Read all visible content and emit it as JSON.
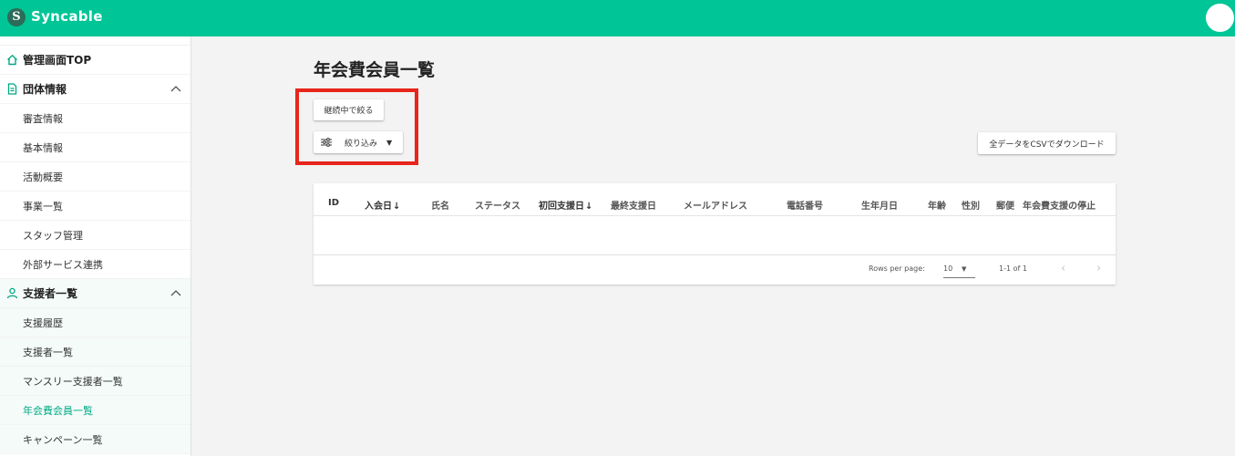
{
  "header": {
    "brand": "Syncable",
    "logo_letter": "S"
  },
  "sidebar": {
    "top": {
      "label": "管理画面TOP",
      "icon": "home-icon"
    },
    "groups": [
      {
        "label": "団体情報",
        "icon": "document-icon",
        "items": [
          "審査情報",
          "基本情報",
          "活動概要",
          "事業一覧",
          "スタッフ管理",
          "外部サービス連携"
        ]
      },
      {
        "label": "支援者一覧",
        "icon": "person-icon",
        "items": [
          "支援履歴",
          "支援者一覧",
          "マンスリー支援者一覧",
          "年会費会員一覧",
          "キャンペーン一覧"
        ],
        "active_item": "年会費会員一覧"
      }
    ]
  },
  "main": {
    "title": "年会費会員一覧",
    "continuing_filter_label": "継続中で絞る",
    "filter_label": "絞り込み",
    "csv_download_label": "全データをCSVでダウンロード"
  },
  "table": {
    "columns": [
      "ID",
      "入会日",
      "氏名",
      "ステータス",
      "初回支援日",
      "最終支援日",
      "メールアドレス",
      "電話番号",
      "生年月日",
      "年齢",
      "性別",
      "郵便",
      "年会費支援の停止"
    ],
    "sorted_columns": [
      "入会日",
      "初回支援日"
    ],
    "rows": [],
    "footer": {
      "rows_per_page_label": "Rows per page:",
      "rows_per_page_value": "10",
      "range": "1-1 of 1"
    }
  },
  "colors": {
    "accent": "#00c596",
    "highlight": "#e8251b",
    "active_text": "#00a883"
  }
}
